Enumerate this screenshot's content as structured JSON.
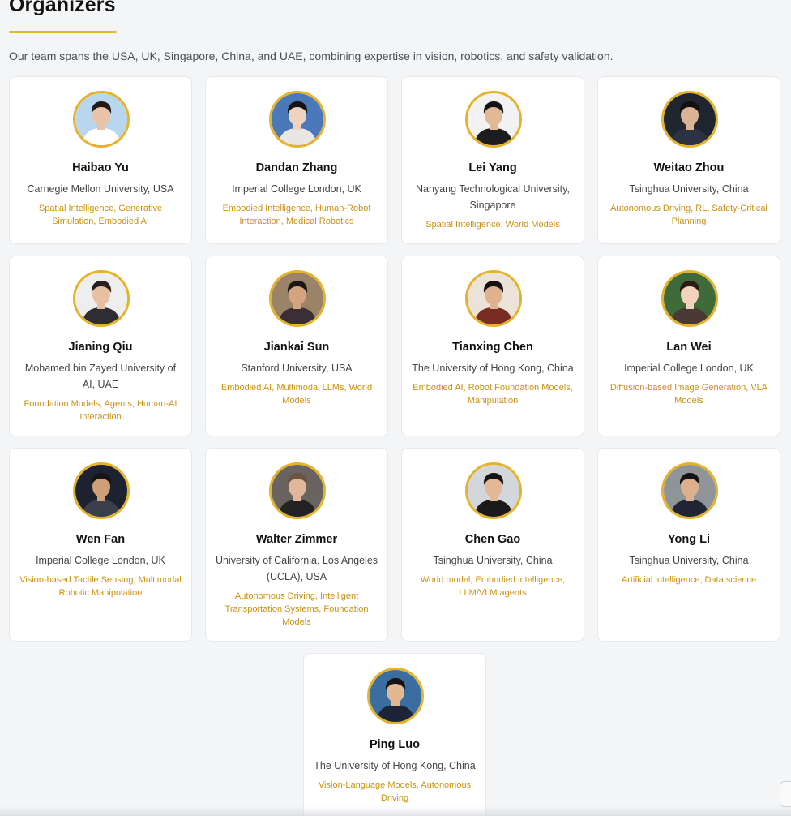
{
  "section": {
    "title": "Organizers",
    "intro": "Our team spans the USA, UK, Singapore, China, and UAE, combining expertise in vision, robotics, and safety validation."
  },
  "colors": {
    "accent": "#e7b22b",
    "topic_text": "#c9920f",
    "background": "#f4f5f7",
    "card": "#ffffff"
  },
  "organizers": [
    {
      "name": "Haibao Yu",
      "affiliation": "Carnegie Mellon University, USA",
      "topics": "Spatial Intelligence, Generative Simulation, Embodied AI",
      "photo": "portrait-photo"
    },
    {
      "name": "Dandan Zhang",
      "affiliation": "Imperial College London, UK",
      "topics": "Embodied Intelligence, Human-Robot Interaction, Medical Robotics",
      "photo": "portrait-photo"
    },
    {
      "name": "Lei Yang",
      "affiliation": "Nanyang Technological University, Singapore",
      "topics": "Spatial Intelligence, World Models",
      "photo": "portrait-photo"
    },
    {
      "name": "Weitao Zhou",
      "affiliation": "Tsinghua University, China",
      "topics": "Autonomous Driving, RL, Safety-Critical Planning",
      "photo": "portrait-photo"
    },
    {
      "name": "Jianing Qiu",
      "affiliation": "Mohamed bin Zayed University of AI, UAE",
      "topics": "Foundation Models, Agents, Human-AI Interaction",
      "photo": "portrait-photo"
    },
    {
      "name": "Jiankai Sun",
      "affiliation": "Stanford University, USA",
      "topics": "Embodied AI, Multimodal LLMs, World Models",
      "photo": "portrait-photo"
    },
    {
      "name": "Tianxing Chen",
      "affiliation": "The University of Hong Kong, China",
      "topics": "Embodied AI, Robot Foundation Models, Manipulation",
      "photo": "portrait-photo"
    },
    {
      "name": "Lan Wei",
      "affiliation": "Imperial College London, UK",
      "topics": "Diffusion-based Image Generation, VLA Models",
      "photo": "portrait-photo"
    },
    {
      "name": "Wen Fan",
      "affiliation": "Imperial College London, UK",
      "topics": "Vision-based Tactile Sensing, Multimodal Robotic Manipulation",
      "photo": "portrait-photo"
    },
    {
      "name": "Walter Zimmer",
      "affiliation": "University of California, Los Angeles (UCLA), USA",
      "topics": "Autonomous Driving, Intelligent Transportation Systems, Foundation Models",
      "photo": "portrait-photo"
    },
    {
      "name": "Chen Gao",
      "affiliation": "Tsinghua University, China",
      "topics": "World model, Embodied intelligence, LLM/VLM agents",
      "photo": "portrait-photo"
    },
    {
      "name": "Yong Li",
      "affiliation": "Tsinghua University, China",
      "topics": "Artificial intelligence, Data science",
      "photo": "portrait-photo"
    },
    {
      "name": "Ping Luo",
      "affiliation": "The University of Hong Kong, China",
      "topics": "Vision-Language Models, Autonomous Driving",
      "photo": "portrait-photo"
    }
  ]
}
